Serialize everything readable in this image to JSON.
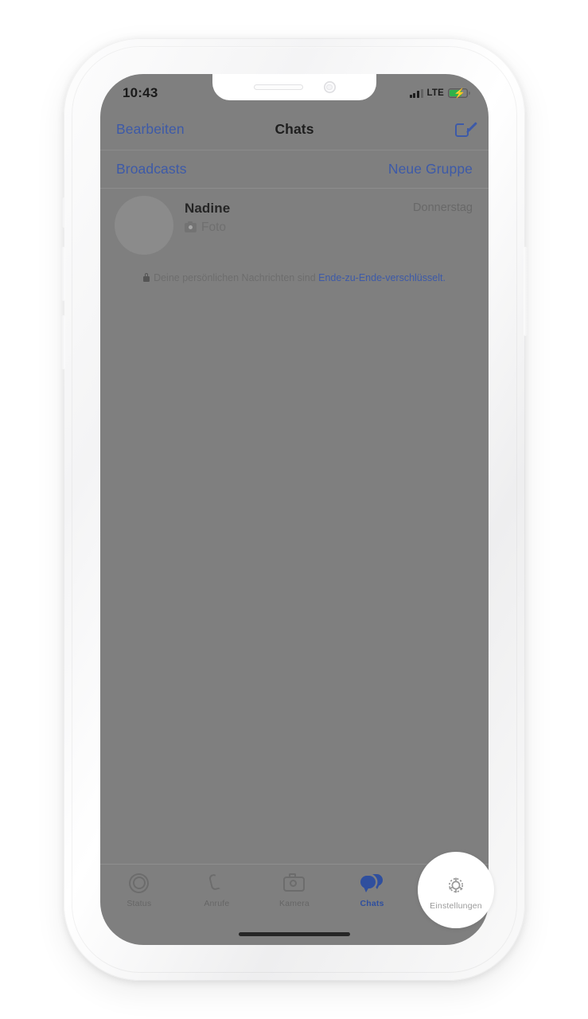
{
  "device": {
    "frame_color": "#f7f7f8",
    "overlay_color": "#7f7f7f"
  },
  "status_bar": {
    "time": "10:43",
    "network_label": "LTE",
    "signal_icon": "signal-bars-icon",
    "battery_icon": "battery-charging-icon",
    "battery_color": "#2fb14a"
  },
  "nav_bar": {
    "left_button": "Bearbeiten",
    "title": "Chats",
    "compose_icon": "compose-icon",
    "accent_color": "#3d5aa8"
  },
  "sub_bar": {
    "left_button": "Broadcasts",
    "right_button": "Neue Gruppe"
  },
  "chats": [
    {
      "name": "Nadine",
      "preview": "Foto",
      "preview_icon": "camera-icon",
      "time": "Donnerstag",
      "avatar_icon": "avatar-placeholder"
    }
  ],
  "encryption_notice": {
    "lock_icon": "lock-icon",
    "text_plain": "Deine persönlichen Nachrichten sind ",
    "text_link": "Ende-zu-Ende-verschlüsselt."
  },
  "tab_bar": {
    "active_color": "#2f4f9e",
    "inactive_color": "#666666",
    "tabs": [
      {
        "label": "Status",
        "icon": "status-rings-icon",
        "active": false
      },
      {
        "label": "Anrufe",
        "icon": "phone-icon",
        "active": false
      },
      {
        "label": "Kamera",
        "icon": "camera-icon",
        "active": false
      },
      {
        "label": "Chats",
        "icon": "chat-bubbles-icon",
        "active": true
      },
      {
        "label": "Einstellungen",
        "icon": "gear-icon",
        "active": false
      }
    ]
  },
  "spotlight": {
    "target_label": "Einstellungen",
    "target_icon": "gear-icon"
  },
  "home_indicator": "home-indicator"
}
